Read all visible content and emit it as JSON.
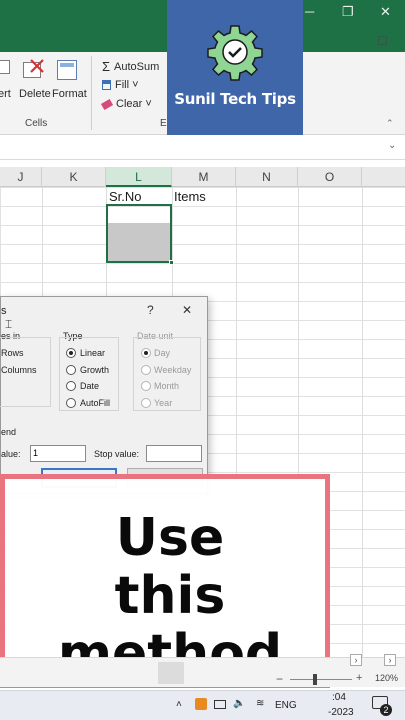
{
  "window": {
    "min_glyph": "─",
    "restore_glyph": "❐",
    "close_glyph": "✕"
  },
  "ribbon": {
    "insert_label": "ert",
    "delete_label": "Delete",
    "format_label": "Format",
    "cells_group": "Cells",
    "autosum_label": "AutoSum",
    "fill_label": "Fill ˅",
    "clear_label": "Clear ˅",
    "editing_group_partial": "E",
    "comment_glyph": "□"
  },
  "brand": {
    "name": "Sunil Tech Tips"
  },
  "columns": [
    "J",
    "K",
    "L",
    "M",
    "N",
    "O"
  ],
  "selected_column": "L",
  "cells": {
    "L1": "Sr.No",
    "M1": "Items"
  },
  "dialog": {
    "title_partial": "s",
    "help": "?",
    "close": "✕",
    "series_in_label": "es in",
    "series_options": [
      "Rows",
      "Columns"
    ],
    "type_label": "Type",
    "type_options": [
      "Linear",
      "Growth",
      "Date",
      "AutoFill"
    ],
    "selected_type": "Linear",
    "date_unit_label": "Date unit",
    "date_unit_options": [
      "Day",
      "Weekday",
      "Month",
      "Year"
    ],
    "trend_label": "end",
    "step_value_label": "alue:",
    "step_value": "1",
    "stop_value_label": "Stop value:",
    "stop_value": ""
  },
  "overlay": {
    "lines": [
      "Use",
      "this",
      "method"
    ]
  },
  "status": {
    "zoom": "120%",
    "minus": "−",
    "plus": "+"
  },
  "taskbar": {
    "lang": "ENG",
    "time_partial": ":04",
    "date_partial": "-2023",
    "notif_count": "2",
    "chevron": "˄"
  },
  "colors": {
    "excel_green": "#1e7145",
    "brand_blue": "#3f66a8",
    "overlay_border": "#e9737f"
  }
}
